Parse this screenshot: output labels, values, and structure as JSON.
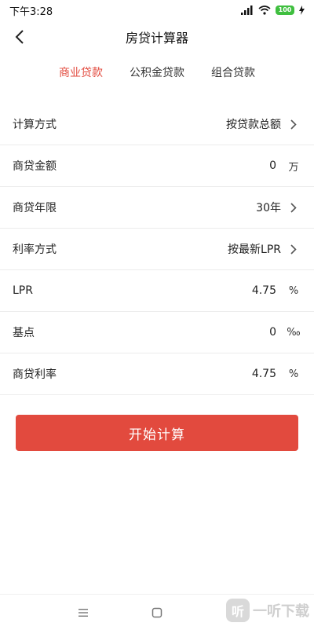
{
  "status_bar": {
    "time": "下午3:28",
    "battery": "100"
  },
  "header": {
    "title": "房贷计算器"
  },
  "tabs": [
    {
      "label": "商业贷款",
      "active": true
    },
    {
      "label": "公积金贷款",
      "active": false
    },
    {
      "label": "组合贷款",
      "active": false
    }
  ],
  "form": {
    "rows": [
      {
        "label": "计算方式",
        "value": "按贷款总额",
        "control": "chevron"
      },
      {
        "label": "商贷金额",
        "value": "0",
        "suffix": "万"
      },
      {
        "label": "商贷年限",
        "value": "30年",
        "control": "chevron"
      },
      {
        "label": "利率方式",
        "value": "按最新LPR",
        "control": "chevron"
      },
      {
        "label": "LPR",
        "value": "4.75",
        "suffix": "%"
      },
      {
        "label": "基点",
        "value": "0",
        "suffix": "‰"
      },
      {
        "label": "商贷利率",
        "value": "4.75",
        "suffix": "%"
      }
    ]
  },
  "calculate_button": {
    "label": "开始计算"
  },
  "watermark": {
    "logo_text": "听",
    "text": "一听下载"
  },
  "colors": {
    "accent": "#e24a3e"
  }
}
